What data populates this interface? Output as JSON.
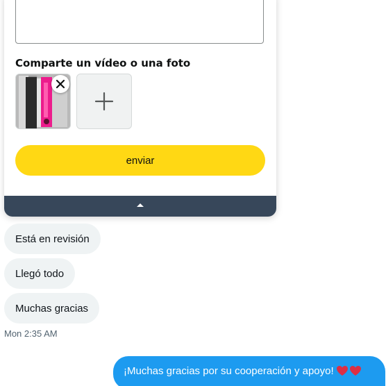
{
  "review_card": {
    "media_section_title": "Comparte un vídeo o una foto",
    "submit_label": "enviar",
    "thumbnail_icon": "product-photo",
    "remove_icon": "close-icon",
    "add_icon": "plus-icon",
    "footer_icon": "chevron-up-icon",
    "accent_color": "#ffd814",
    "footer_color": "#37475a"
  },
  "messages": {
    "incoming": [
      {
        "text": "Está en revisión"
      },
      {
        "text": "Llegó todo"
      },
      {
        "text": "Muchas gracias"
      }
    ],
    "timestamp": "Mon 2:35 AM",
    "outgoing": {
      "text": "¡Muchas gracias por su cooperación y apoyo!",
      "emoji": "heart-icons",
      "color": "#1d9bf0"
    }
  }
}
